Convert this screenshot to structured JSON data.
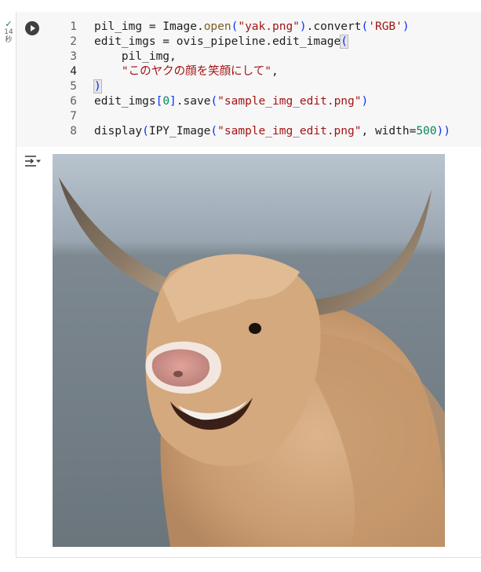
{
  "status": {
    "check": "✓",
    "time_value": "14",
    "time_unit": "秒"
  },
  "cell": {
    "run_icon": "play-circle-icon",
    "code_lines": [
      {
        "num": "1",
        "parts": [
          {
            "t": "pil_img = Image.",
            "c": ""
          },
          {
            "t": "open",
            "c": "fn"
          },
          {
            "t": "(",
            "c": "br"
          },
          {
            "t": "\"yak.png\"",
            "c": "str"
          },
          {
            "t": ")",
            "c": "br"
          },
          {
            "t": ".convert",
            "c": ""
          },
          {
            "t": "(",
            "c": "br"
          },
          {
            "t": "'RGB'",
            "c": "str"
          },
          {
            "t": ")",
            "c": "br"
          }
        ]
      },
      {
        "num": "2",
        "parts": [
          {
            "t": "edit_imgs = ovis_pipeline.edit_image",
            "c": ""
          },
          {
            "t": "(",
            "c": "brhl"
          }
        ]
      },
      {
        "num": "3",
        "parts": [
          {
            "t": "    pil_img,",
            "c": ""
          }
        ]
      },
      {
        "num": "4",
        "parts": [
          {
            "t": "    ",
            "c": ""
          },
          {
            "t": "\"このヤクの顔を笑顔にして\"",
            "c": "str"
          },
          {
            "t": ",",
            "c": ""
          }
        ]
      },
      {
        "num": "5",
        "parts": [
          {
            "t": ")",
            "c": "brhl"
          }
        ]
      },
      {
        "num": "6",
        "parts": [
          {
            "t": "edit_imgs",
            "c": ""
          },
          {
            "t": "[",
            "c": "br"
          },
          {
            "t": "0",
            "c": "num"
          },
          {
            "t": "]",
            "c": "br"
          },
          {
            "t": ".save",
            "c": ""
          },
          {
            "t": "(",
            "c": "br"
          },
          {
            "t": "\"sample_img_edit.png\"",
            "c": "str"
          },
          {
            "t": ")",
            "c": "br"
          }
        ]
      },
      {
        "num": "7",
        "parts": []
      },
      {
        "num": "8",
        "parts": [
          {
            "t": "display",
            "c": ""
          },
          {
            "t": "(",
            "c": "br"
          },
          {
            "t": "IPY_Image",
            "c": ""
          },
          {
            "t": "(",
            "c": "br"
          },
          {
            "t": "\"sample_img_edit.png\"",
            "c": "str"
          },
          {
            "t": ", width=",
            "c": ""
          },
          {
            "t": "500",
            "c": "num"
          },
          {
            "t": "))",
            "c": "br"
          }
        ]
      }
    ],
    "active_line": "4"
  },
  "output": {
    "toggle_icon": "output-options-icon",
    "image_subject": "smiling-yak-photo",
    "colors": {
      "sky_top": "#b4bfcb",
      "sea": "#7f8b94",
      "fur": "#cfa27a",
      "horn": "#8c7a66"
    }
  }
}
